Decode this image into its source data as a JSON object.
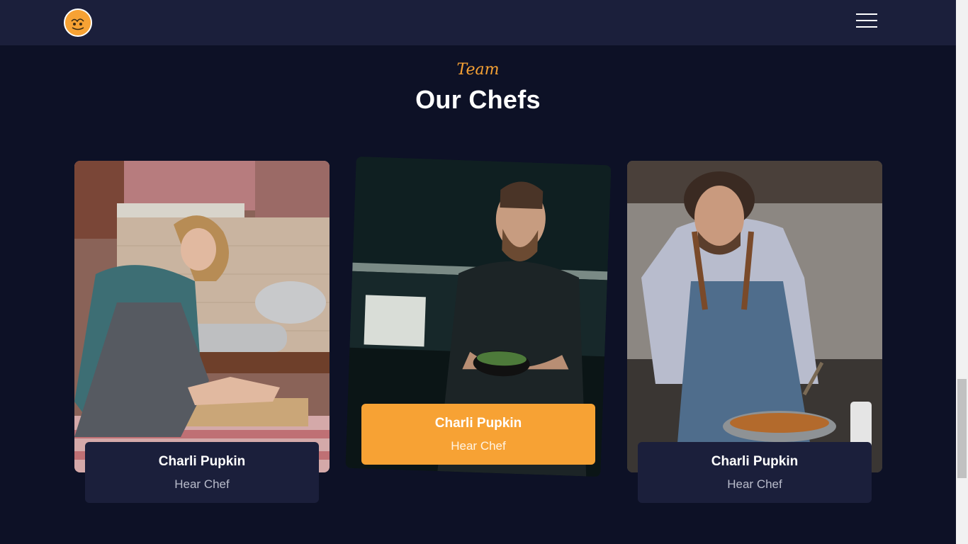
{
  "header": {
    "logo_icon": "chef-logo-icon",
    "menu_icon": "hamburger-menu-icon"
  },
  "section": {
    "subtitle": "Team",
    "title": "Our Chefs"
  },
  "chefs": [
    {
      "name": "Charli Pupkin",
      "role": "Hear Chef",
      "photo": "woman-rolling-dough-photo"
    },
    {
      "name": "Charli Pupkin",
      "role": "Hear Chef",
      "photo": "bearded-chef-holding-bowl-photo"
    },
    {
      "name": "Charli Pupkin",
      "role": "Hear Chef",
      "photo": "chef-cooking-pan-photo"
    }
  ],
  "colors": {
    "accent": "#f7a234",
    "header_bg": "#1b1f3b",
    "page_bg": "#0d1126",
    "card_info_bg": "#1b1f3b"
  }
}
